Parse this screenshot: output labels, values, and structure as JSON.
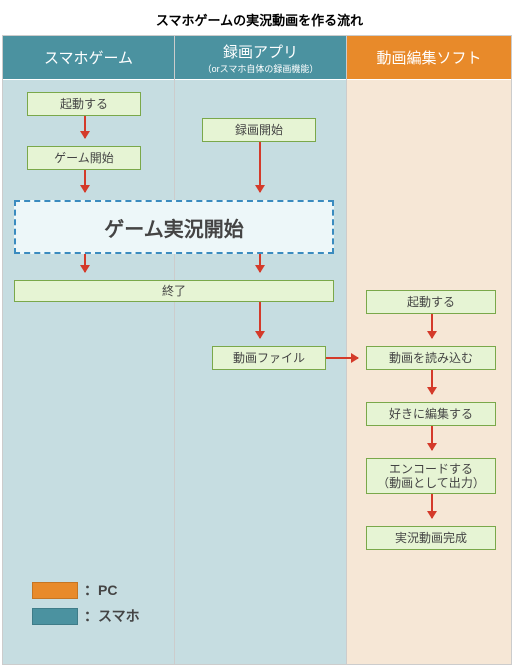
{
  "title": "スマホゲームの実況動画を作る流れ",
  "columns": {
    "c1": {
      "label": "スマホゲーム"
    },
    "c2": {
      "label": "録画アプリ",
      "sub": "（orスマホ自体の録画機能）"
    },
    "c3": {
      "label": "動画編集ソフト"
    }
  },
  "steps": {
    "launch_game": "起動する",
    "start_game": "ゲーム開始",
    "start_rec": "録画開始",
    "play_start": "ゲーム実況開始",
    "end": "終了",
    "video_file": "動画ファイル",
    "launch_editor": "起動する",
    "import": "動画を読み込む",
    "edit": "好きに編集する",
    "encode_l1": "エンコードする",
    "encode_l2": "（動画として出力）",
    "done": "実況動画完成"
  },
  "legend": {
    "pc": "：PC",
    "sp": "：スマホ"
  },
  "chart_data": {
    "type": "flowchart-swimlane",
    "title": "スマホゲームの実況動画を作る流れ",
    "lanes": [
      {
        "id": "game",
        "label": "スマホゲーム",
        "device": "スマホ"
      },
      {
        "id": "rec",
        "label": "録画アプリ（orスマホ自体の録画機能）",
        "device": "スマホ"
      },
      {
        "id": "edit",
        "label": "動画編集ソフト",
        "device": "PC"
      }
    ],
    "nodes": [
      {
        "id": "n1",
        "lane": "game",
        "label": "起動する"
      },
      {
        "id": "n2",
        "lane": "game",
        "label": "ゲーム開始"
      },
      {
        "id": "n3",
        "lane": "rec",
        "label": "録画開始"
      },
      {
        "id": "n4",
        "lane": [
          "game",
          "rec"
        ],
        "label": "ゲーム実況開始",
        "emphasis": true
      },
      {
        "id": "n5",
        "lane": [
          "game",
          "rec"
        ],
        "label": "終了"
      },
      {
        "id": "n6",
        "lane": "rec",
        "label": "動画ファイル"
      },
      {
        "id": "n7",
        "lane": "edit",
        "label": "起動する"
      },
      {
        "id": "n8",
        "lane": "edit",
        "label": "動画を読み込む"
      },
      {
        "id": "n9",
        "lane": "edit",
        "label": "好きに編集する"
      },
      {
        "id": "n10",
        "lane": "edit",
        "label": "エンコードする（動画として出力）"
      },
      {
        "id": "n11",
        "lane": "edit",
        "label": "実況動画完成"
      }
    ],
    "edges": [
      [
        "n1",
        "n2"
      ],
      [
        "n2",
        "n4"
      ],
      [
        "n3",
        "n4"
      ],
      [
        "n4",
        "n5"
      ],
      [
        "n5",
        "n6"
      ],
      [
        "n6",
        "n8"
      ],
      [
        "n7",
        "n8"
      ],
      [
        "n8",
        "n9"
      ],
      [
        "n9",
        "n10"
      ],
      [
        "n10",
        "n11"
      ]
    ],
    "legend": [
      {
        "color": "#e88a2a",
        "label": "PC"
      },
      {
        "color": "#4b92a0",
        "label": "スマホ"
      }
    ]
  }
}
